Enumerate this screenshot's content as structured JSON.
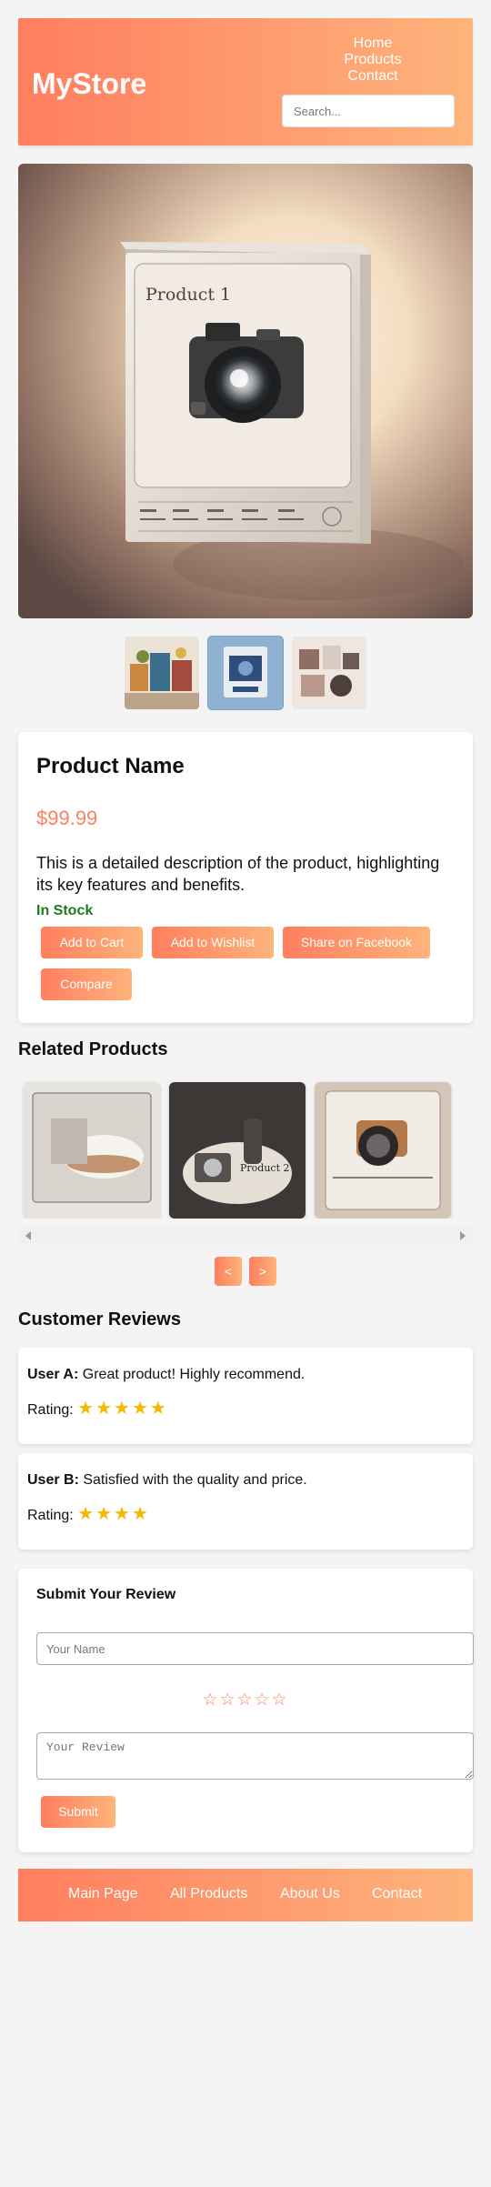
{
  "header": {
    "logo": "MyStore",
    "nav": [
      "Home",
      "Products",
      "Contact"
    ],
    "search_placeholder": "Search..."
  },
  "product": {
    "name": "Product Name",
    "price": "$99.99",
    "description": "This is a detailed description of the product, highlighting its key features and benefits.",
    "stock": "In Stock",
    "image_label": "Product 1",
    "buttons": [
      "Add to Cart",
      "Add to Wishlist",
      "Share on Facebook",
      "Compare"
    ]
  },
  "related": {
    "title": "Related Products",
    "prev_label": "<",
    "next_label": ">"
  },
  "reviews": {
    "title": "Customer Reviews",
    "rating_label": "Rating:",
    "items": [
      {
        "user": "User A:",
        "text": "Great product! Highly recommend.",
        "stars": "★★★★★",
        "rating": 5
      },
      {
        "user": "User B:",
        "text": "Satisfied with the quality and price.",
        "stars": "★★★★",
        "rating": 4
      }
    ]
  },
  "review_form": {
    "title": "Submit Your Review",
    "name_placeholder": "Your Name",
    "stars": "☆☆☆☆☆",
    "review_placeholder": "Your Review",
    "submit_label": "Submit"
  },
  "footer": {
    "links": [
      "Main Page",
      "All Products",
      "About Us",
      "Contact"
    ]
  },
  "colors": {
    "accent_start": "#ff7e5f",
    "accent_end": "#feb47b",
    "stock_green": "#1c7a1c",
    "star_gold": "#f5b800"
  }
}
